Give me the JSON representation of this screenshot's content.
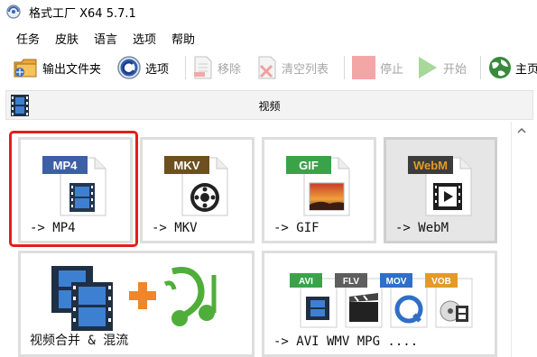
{
  "window": {
    "title": "格式工厂 X64 5.7.1"
  },
  "menu": [
    "任务",
    "皮肤",
    "语言",
    "选项",
    "帮助"
  ],
  "toolbar": {
    "output_folder": "输出文件夹",
    "options": "选项",
    "remove": "移除",
    "clear_list": "清空列表",
    "stop": "停止",
    "start": "开始",
    "home": "主页"
  },
  "category": {
    "title": "视频"
  },
  "tiles": [
    {
      "badge": "MP4",
      "label": "-> MP4",
      "badge_color": "#3d5fa5"
    },
    {
      "badge": "MKV",
      "label": "-> MKV",
      "badge_color": "#6d4f20"
    },
    {
      "badge": "GIF",
      "label": "-> GIF",
      "badge_color": "#3aa34a"
    },
    {
      "badge": "WebM",
      "label": "-> WebM",
      "badge_color": "#b7741c"
    },
    {
      "label": "视频合并 & 混流"
    },
    {
      "label": "-> AVI WMV MPG ....",
      "badges": [
        "AVI",
        "FLV",
        "MOV",
        "VOB"
      ]
    }
  ],
  "colors": {
    "highlight": "#e51d1d",
    "disabled_text": "#a5a5a5",
    "selected_tile": "#e6e6e6"
  }
}
